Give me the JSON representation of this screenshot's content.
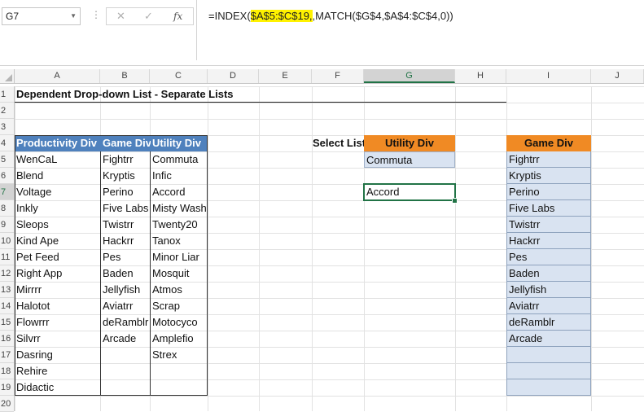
{
  "formula_bar": {
    "name_box": "G7",
    "formula_parts": [
      {
        "text": "=INDEX(",
        "highlight": false
      },
      {
        "text": "$A$5:$C$19,",
        "highlight": true
      },
      {
        "text": ",MATCH(",
        "highlight": false
      },
      {
        "text": "$G$4,$A$4:$C$4,0))",
        "highlight": false
      }
    ],
    "cancel_symbol": "✕",
    "enter_symbol": "✓",
    "fx_symbol": "fx"
  },
  "columns": [
    "A",
    "B",
    "C",
    "D",
    "E",
    "F",
    "G",
    "H",
    "I",
    "J"
  ],
  "selected_column": "G",
  "rows": [
    "1",
    "2",
    "3",
    "4",
    "5",
    "6",
    "7",
    "8",
    "9",
    "10",
    "11",
    "12",
    "13",
    "14",
    "15",
    "16",
    "17",
    "18",
    "19",
    "20"
  ],
  "selected_row": "7",
  "sheet": {
    "title": "Dependent Drop-down List - Separate Lists",
    "table_headers": [
      "Productivity Div",
      "Game Div",
      "Utility Div"
    ],
    "productivity": [
      "WenCaL",
      "Blend",
      "Voltage",
      "Inkly",
      "Sleops",
      "Kind Ape",
      "Pet Feed",
      "Right App",
      "Mirrrr",
      "Halotot",
      "Flowrrr",
      "Silvrr",
      "Dasring",
      "Rehire",
      "Didactic"
    ],
    "game": [
      "Fightrr",
      "Kryptis",
      "Perino",
      "Five Labs",
      "Twistrr",
      "Hackrr",
      "Pes",
      "Baden",
      "Jellyfish",
      "Aviatrr",
      "deRamblr",
      "Arcade"
    ],
    "utility": [
      "Commuta",
      "Infic",
      "Accord",
      "Misty Wash",
      "Twenty20",
      "Tanox",
      "Minor Liar",
      "Mosquit",
      "Atmos",
      "Scrap",
      "Motocyco",
      "Amplefio",
      "Strex"
    ],
    "select_list_label": "Select List",
    "g4_header": "Utility Div",
    "g5_value": "Commuta",
    "g7_value": "Accord",
    "i4_header": "Game Div",
    "i_list": [
      "Fightrr",
      "Kryptis",
      "Perino",
      "Five Labs",
      "Twistrr",
      "Hackrr",
      "Pes",
      "Baden",
      "Jellyfish",
      "Aviatrr",
      "deRamblr",
      "Arcade",
      "",
      "",
      ""
    ]
  },
  "colors": {
    "header_blue": "#4f81bd",
    "header_orange": "#f08a24",
    "light_blue_fill": "#d9e3f1",
    "highlight_yellow": "#fff200",
    "excel_green": "#217346"
  }
}
